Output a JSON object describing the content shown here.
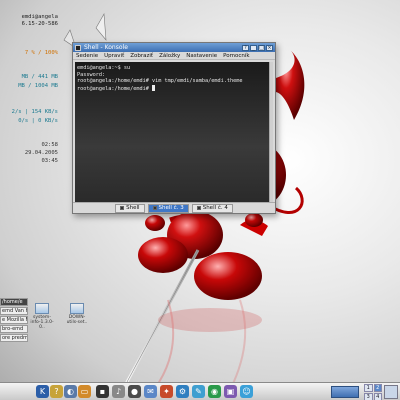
{
  "monitor": {
    "host": "emdi@angela",
    "kernel": "6.15-20-586",
    "cpu": "7 % / 100%",
    "mem1": "MB / 441 MB",
    "mem2": "MB / 1004 MB",
    "net1": "2/s | 154 KB/s",
    "net2": "0/s | 0 KB/s",
    "time": "02:58",
    "date": "29.04.2005",
    "uptime": "03:45"
  },
  "window": {
    "title": "Shell - Konsole",
    "menu": [
      "Sedenie",
      "Upraviť",
      "Zobraziť",
      "Záložky",
      "Nastavenie",
      "Pomocník"
    ],
    "lines": [
      "emdi@angela:~$ su",
      "Password:",
      "root@angela:/home/emdi# vim tmp/emdi/samba/emdi.theme",
      "root@angela:/home/emdi# "
    ],
    "tabs": [
      "Shell",
      "Shell č. 3",
      "Shell č. 4"
    ],
    "active_tab": 1
  },
  "desktop_icons": [
    {
      "label": "system-info-1.3.0-0.."
    },
    {
      "label": "DOWN-utils-set.."
    }
  ],
  "left_panel": {
    "items": [
      "/home/e",
      "emd Van He",
      "e Mozilla Fire",
      "bro-emd",
      "ore predm"
    ]
  },
  "taskbar": {
    "pager": [
      "1",
      "2",
      "3",
      "4"
    ],
    "current_desktop": "2",
    "icons": [
      "kde-k-icon",
      "help-icon",
      "globe-icon",
      "folder-icon",
      "terminal-icon",
      "speaker-icon",
      "media-icon",
      "mail-icon",
      "mozilla-icon",
      "settings-icon",
      "editor-icon",
      "network-icon",
      "photo-icon",
      "chat-icon"
    ]
  },
  "colors": {
    "devil_red": "#b30000",
    "title_blue": "#3d6fb3",
    "terminal_bg": "#202020"
  }
}
